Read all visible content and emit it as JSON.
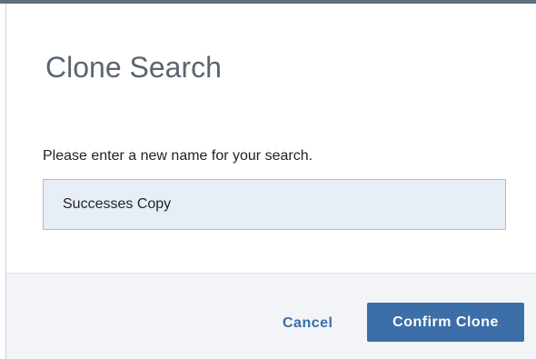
{
  "dialog": {
    "title": "Clone Search",
    "instruction": "Please enter a new name for your search.",
    "name_input": {
      "value": "Successes Copy",
      "placeholder": ""
    },
    "buttons": {
      "cancel_label": "Cancel",
      "confirm_label": "Confirm Clone"
    }
  },
  "colors": {
    "accent": "#3c6ea8",
    "title_text": "#5a6570",
    "input_background": "#e8eef5",
    "footer_background": "#f2f4f7"
  }
}
